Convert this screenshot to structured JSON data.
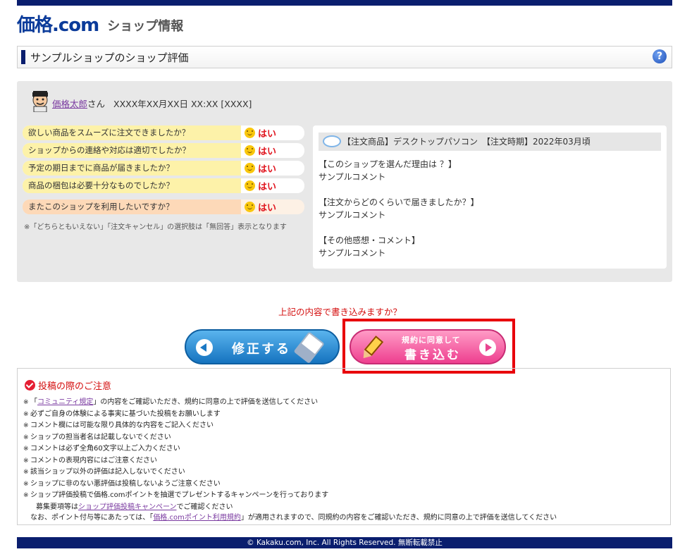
{
  "header": {
    "logo_main": "価格.com",
    "logo_sub": "ショップ情報"
  },
  "titlebar": {
    "title": "サンプルショップのショップ評価",
    "help_label": "?"
  },
  "review": {
    "user_name": "価格太郎",
    "user_suffix": "さん",
    "datetime": "XXXX年XX月XX日 XX:XX [XXXX]",
    "questions": [
      {
        "q": "欲しい商品をスムーズに注文できましたか？",
        "a": "はい"
      },
      {
        "q": "ショップからの連絡や対応は適切でしたか？",
        "a": "はい"
      },
      {
        "q": "予定の期日までに商品が届きましたか？",
        "a": "はい"
      },
      {
        "q": "商品の梱包は必要十分なものでしたか？",
        "a": "はい"
      },
      {
        "q": "またこのショップを利用したいですか？",
        "a": "はい"
      }
    ],
    "note": "※「どちらともいえない」「注文キャンセル」の選択肢は「無回答」表示となります",
    "comment_head": "【注文商品】デスクトップパソコン　【注文時期】2022年03月頃",
    "comments": [
      {
        "title": "【このショップを選んだ理由は ？】",
        "body": "サンプルコメント"
      },
      {
        "title": "【注文からどのくらいで届きましたか？】",
        "body": "サンプルコメント"
      },
      {
        "title": "【その他感想・コメント】",
        "body": "サンプルコメント"
      }
    ]
  },
  "confirm_text": "上記の内容で書き込みますか？",
  "buttons": {
    "fix_label": "修正する",
    "write_small": "規約に同意して",
    "write_big": "書き込む"
  },
  "notes": {
    "title": "投稿の際のご注意",
    "mark": "※",
    "items": [
      {
        "pre": "「",
        "link": "コミュニティ規定",
        "post": "」の内容をご確認いただき、規約に同意の上で評価を送信してください"
      },
      {
        "text": "必ずご自身の体験による事実に基づいた投稿をお願いします"
      },
      {
        "text": "コメント欄には可能な限り具体的な内容をご記入ください"
      },
      {
        "text": "ショップの担当者名は記載しないでください"
      },
      {
        "text": "コメントは必ず全角60文字以上ご入力ください"
      },
      {
        "text": "コメントの表現内容にはご注意ください"
      },
      {
        "text": "該当ショップ以外の評価は記入しないでください"
      },
      {
        "text": "ショップに非のない悪評価は投稿しないようご注意ください"
      },
      {
        "text": "ショップ評価投稿で価格.comポイントを抽選でプレゼントするキャンペーンを行っております"
      }
    ],
    "campaign_pre": "募集要項等は",
    "campaign_link": "ショップ評価投稿キャンペーン",
    "campaign_post": "でご確認ください",
    "points_pre": "なお、ポイント付与等にあたっては、「",
    "points_link": "価格.comポイント利用規約",
    "points_post": "」が適用されますので、同規約の内容をご確認いただき、規約に同意の上で評価を送信してください"
  },
  "footer": "© Kakaku.com, Inc. All Rights Reserved. 無断転載禁止"
}
